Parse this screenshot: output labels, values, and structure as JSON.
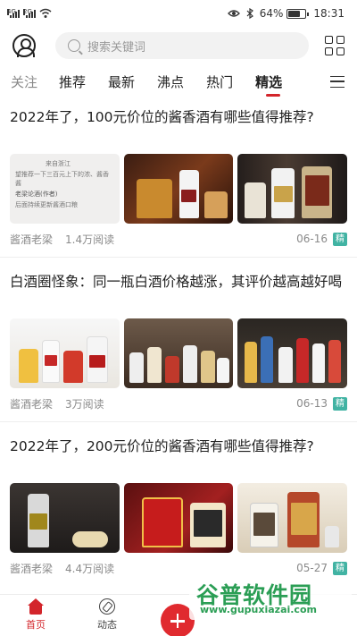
{
  "status_bar": {
    "signal_1": "4G",
    "signal_2": "2G",
    "battery": "64%",
    "time": "18:31"
  },
  "header": {
    "search_placeholder": "搜索关键词"
  },
  "tabs": [
    {
      "label": "关注"
    },
    {
      "label": "推荐"
    },
    {
      "label": "最新"
    },
    {
      "label": "沸点"
    },
    {
      "label": "热门"
    },
    {
      "label": "精选"
    }
  ],
  "articles": [
    {
      "title": "2022年了，100元价位的酱香酒有哪些值得推荐?",
      "preview_lines": [
        "来自浙江",
        "望推荐一下三百元上下的浓、酱香",
        "酱",
        "老梁论酒(作者)",
        "后面持续更新酱酒口粮"
      ],
      "author": "酱酒老梁",
      "reads": "1.4万阅读",
      "date": "06-16",
      "tag": "精"
    },
    {
      "title": "白酒圈怪象：同一瓶白酒价格越涨，其评价越高越好喝",
      "author": "酱酒老梁",
      "reads": "3万阅读",
      "date": "06-13",
      "tag": "精"
    },
    {
      "title": "2022年了，200元价位的酱香酒有哪些值得推荐?",
      "author": "酱酒老梁",
      "reads": "4.4万阅读",
      "date": "05-27",
      "tag": "精"
    }
  ],
  "watermark": {
    "title": "谷普软件园",
    "url": "www.gupuxiazai.com"
  },
  "bottom_nav": {
    "home": "首页",
    "moments": "动态"
  },
  "colors": {
    "accent": "#d3252b",
    "tag": "#41b3a3",
    "watermark": "#2b9e55"
  }
}
